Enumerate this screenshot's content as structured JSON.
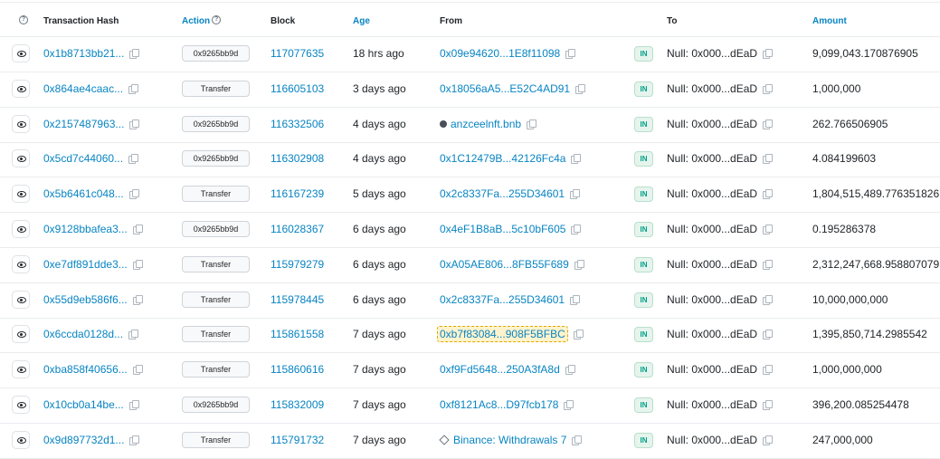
{
  "columns": {
    "info_icon": "?",
    "tx_hash": "Transaction Hash",
    "action": "Action",
    "action_icon": "?",
    "block": "Block",
    "age": "Age",
    "from": "From",
    "to": "To",
    "amount": "Amount"
  },
  "icons": {
    "row_view": "eye-icon",
    "copy": "copy-icon",
    "ens": "globe-icon",
    "exchange": "diamond-icon"
  },
  "colors": {
    "link": "#0784c3",
    "in_badge_text": "#00a186",
    "in_badge_bg": "#e6f4ee",
    "highlight_border": "#e0a800"
  },
  "rows": [
    {
      "hash": "0x1b8713bb21...",
      "method": "0x9265bb9d",
      "block": "117077635",
      "age": "18 hrs ago",
      "from": "0x09e94620...1E8f11098",
      "direction": "IN",
      "to": "Null: 0x000...dEaD",
      "amount": "9,099,043.170876905"
    },
    {
      "hash": "0x864ae4caac...",
      "method": "Transfer",
      "block": "116605103",
      "age": "3 days ago",
      "from": "0x18056aA5...E52C4AD91",
      "direction": "IN",
      "to": "Null: 0x000...dEaD",
      "amount": "1,000,000"
    },
    {
      "hash": "0x2157487963...",
      "method": "0x9265bb9d",
      "block": "116332506",
      "age": "4 days ago",
      "from": "anzceelnft.bnb",
      "direction": "IN",
      "to": "Null: 0x000...dEaD",
      "amount": "262.766506905"
    },
    {
      "hash": "0x5cd7c44060...",
      "method": "0x9265bb9d",
      "block": "116302908",
      "age": "4 days ago",
      "from": "0x1C12479B...42126Fc4a",
      "direction": "IN",
      "to": "Null: 0x000...dEaD",
      "amount": "4.084199603"
    },
    {
      "hash": "0x5b6461c048...",
      "method": "Transfer",
      "block": "116167239",
      "age": "5 days ago",
      "from": "0x2c8337Fa...255D34601",
      "direction": "IN",
      "to": "Null: 0x000...dEaD",
      "amount": "1,804,515,489.776351826"
    },
    {
      "hash": "0x9128bbafea3...",
      "method": "0x9265bb9d",
      "block": "116028367",
      "age": "6 days ago",
      "from": "0x4eF1B8aB...5c10bF605",
      "direction": "IN",
      "to": "Null: 0x000...dEaD",
      "amount": "0.195286378"
    },
    {
      "hash": "0xe7df891dde3...",
      "method": "Transfer",
      "block": "115979279",
      "age": "6 days ago",
      "from": "0xA05AE806...8FB55F689",
      "direction": "IN",
      "to": "Null: 0x000...dEaD",
      "amount": "2,312,247,668.958807079"
    },
    {
      "hash": "0x55d9eb586f6...",
      "method": "Transfer",
      "block": "115978445",
      "age": "6 days ago",
      "from": "0x2c8337Fa...255D34601",
      "direction": "IN",
      "to": "Null: 0x000...dEaD",
      "amount": "10,000,000,000"
    },
    {
      "hash": "0x6ccda0128d...",
      "method": "Transfer",
      "block": "115861558",
      "age": "7 days ago",
      "from": "0xb7f83084...908F5BFBC",
      "direction": "IN",
      "to": "Null: 0x000...dEaD",
      "amount": "1,395,850,714.2985542"
    },
    {
      "hash": "0xba858f40656...",
      "method": "Transfer",
      "block": "115860616",
      "age": "7 days ago",
      "from": "0xf9Fd5648...250A3fA8d",
      "direction": "IN",
      "to": "Null: 0x000...dEaD",
      "amount": "1,000,000,000"
    },
    {
      "hash": "0x10cb0a14be...",
      "method": "0x9265bb9d",
      "block": "115832009",
      "age": "7 days ago",
      "from": "0xf8121Ac8...D97fcb178",
      "direction": "IN",
      "to": "Null: 0x000...dEaD",
      "amount": "396,200.085254478"
    },
    {
      "hash": "0x9d897732d1...",
      "method": "Transfer",
      "block": "115791732",
      "age": "7 days ago",
      "from": "Binance: Withdrawals 7",
      "direction": "IN",
      "to": "Null: 0x000...dEaD",
      "amount": "247,000,000"
    }
  ]
}
